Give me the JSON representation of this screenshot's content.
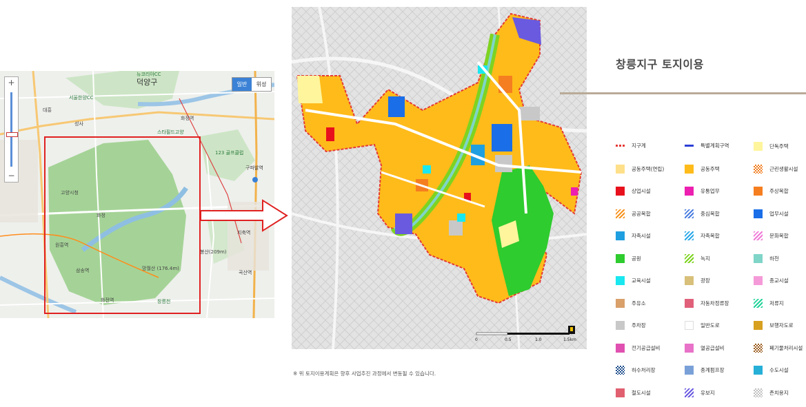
{
  "overview_map": {
    "map_type_buttons": [
      "일반",
      "위성"
    ],
    "zoom_in": "+",
    "zoom_out": "−",
    "labels": {
      "deokyang": "덕양구",
      "seoul_hanyang_cc": "서울한양CC",
      "lucky_cc": "뉴코리아CC",
      "daehoon": "대흥",
      "seongsa": "성사",
      "hwajeong": "화정역",
      "startfield": "스타필드고양",
      "golf": "123 골프클럽",
      "goyang_office": "고양시청",
      "hwajeong2": "화정",
      "wonheung": "원흥역",
      "samsong": "삼송역",
      "jichuk": "지축역",
      "gupabal": "구파발역",
      "bongsan": "봉산(209m)",
      "mangwolsan": "망월산 (176.4m)",
      "goksan": "곡산역",
      "hwaseong": "화전역",
      "changneung": "창릉천"
    }
  },
  "land_use_map": {
    "scale_labels": [
      "0",
      "0.5",
      "1.0",
      "1.5km"
    ]
  },
  "note": "※ 위 토지이용계획은 향후 사업추진 과정에서 변동될 수 있습니다.",
  "legend": {
    "title": "창릉지구 토지이용",
    "items": [
      {
        "label": "지구계",
        "color": "#e53935",
        "pattern": "dashed-line"
      },
      {
        "label": "특별계획구역",
        "color": "#2b3fd6",
        "pattern": "line"
      },
      {
        "label": "단독주택",
        "color": "#fff59d",
        "pattern": "solid"
      },
      {
        "label": "공동주택(연립)",
        "color": "#ffe08a",
        "pattern": "solid"
      },
      {
        "label": "공동주택",
        "color": "#ffbb1a",
        "pattern": "solid"
      },
      {
        "label": "근린생활시설",
        "color": "#f07a1a",
        "pattern": "checker"
      },
      {
        "label": "상업시설",
        "color": "#e8101c",
        "pattern": "solid"
      },
      {
        "label": "유통업무",
        "color": "#ec1fb0",
        "pattern": "solid"
      },
      {
        "label": "주상복합",
        "color": "#f57e20",
        "pattern": "solid"
      },
      {
        "label": "공공복합",
        "color": "#f7931e",
        "pattern": "stripe"
      },
      {
        "label": "중심복합",
        "color": "#4a7de0",
        "pattern": "stripe"
      },
      {
        "label": "업무시설",
        "color": "#1a6ee8",
        "pattern": "solid"
      },
      {
        "label": "자족시설",
        "color": "#1f9fe0",
        "pattern": "solid"
      },
      {
        "label": "자족복합",
        "color": "#2aa8e8",
        "pattern": "stripe"
      },
      {
        "label": "문화복합",
        "color": "#f07ad8",
        "pattern": "stripe"
      },
      {
        "label": "공원",
        "color": "#2ecc2e",
        "pattern": "solid"
      },
      {
        "label": "녹지",
        "color": "#7ed321",
        "pattern": "stripe"
      },
      {
        "label": "하천",
        "color": "#7fd5c8",
        "pattern": "solid"
      },
      {
        "label": "교육시설",
        "color": "#19e8f0",
        "pattern": "solid"
      },
      {
        "label": "광장",
        "color": "#d8c07a",
        "pattern": "solid"
      },
      {
        "label": "종교시설",
        "color": "#f59ad8",
        "pattern": "solid"
      },
      {
        "label": "주유소",
        "color": "#d9a06a",
        "pattern": "solid"
      },
      {
        "label": "자동차정류장",
        "color": "#e0607a",
        "pattern": "solid"
      },
      {
        "label": "저류지",
        "color": "#22d39a",
        "pattern": "stripe"
      },
      {
        "label": "주차장",
        "color": "#c8c8c8",
        "pattern": "solid"
      },
      {
        "label": "일반도로",
        "color": "#ffffff",
        "pattern": "solid"
      },
      {
        "label": "보행자도로",
        "color": "#d8a020",
        "pattern": "solid"
      },
      {
        "label": "전기공급설비",
        "color": "#e050b0",
        "pattern": "solid"
      },
      {
        "label": "열공급설비",
        "color": "#e872c8",
        "pattern": "solid"
      },
      {
        "label": "폐기물처리시설",
        "color": "#9a5a1a",
        "pattern": "checker"
      },
      {
        "label": "하수처리장",
        "color": "#1a4a8a",
        "pattern": "checker"
      },
      {
        "label": "종계펌프장",
        "color": "#7aa0d8",
        "pattern": "solid"
      },
      {
        "label": "수도시설",
        "color": "#26b0d8",
        "pattern": "solid"
      },
      {
        "label": "철도시설",
        "color": "#e06070",
        "pattern": "solid"
      },
      {
        "label": "유보지",
        "color": "#6a5ae0",
        "pattern": "stripe"
      },
      {
        "label": "존치용지",
        "color": "#bfbfbf",
        "pattern": "checker"
      }
    ]
  }
}
